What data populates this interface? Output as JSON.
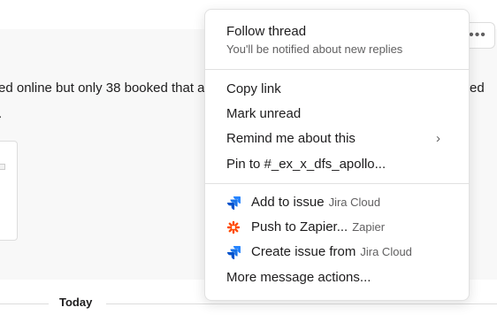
{
  "message": {
    "text_left": "ed online but only 38 booked that ar",
    "text_right": "ed",
    "text_line2": "."
  },
  "more_actions_button": "•••",
  "divider": {
    "label": "Today"
  },
  "menu": {
    "follow_thread": {
      "label": "Follow thread",
      "sub": "You'll be notified about new replies"
    },
    "copy_link": "Copy link",
    "mark_unread": "Mark unread",
    "remind_me": {
      "label": "Remind me about this",
      "chevron": "›"
    },
    "pin_to": "Pin to #_ex_x_dfs_apollo...",
    "add_to_issue": {
      "label": "Add to issue",
      "app": "Jira Cloud",
      "icon": "jira-icon"
    },
    "push_to_zapier": {
      "label": "Push to Zapier...",
      "app": "Zapier",
      "icon": "zapier-icon"
    },
    "create_issue": {
      "label": "Create issue from",
      "app": "Jira Cloud",
      "icon": "jira-icon"
    },
    "more_message_actions": "More message actions..."
  },
  "colors": {
    "jira": "#2684ff",
    "jira_dark": "#0052cc",
    "zapier": "#ff4a00"
  }
}
